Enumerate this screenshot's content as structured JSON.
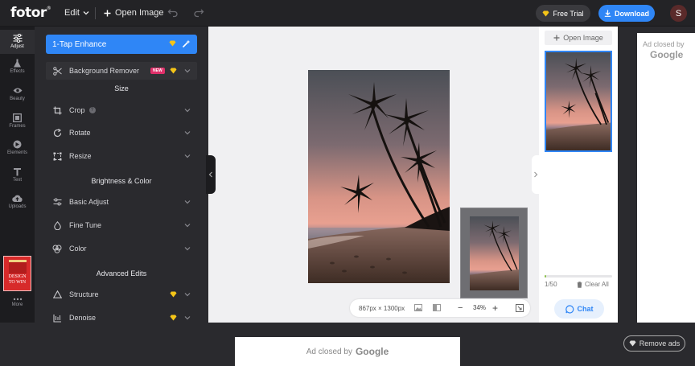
{
  "app": {
    "logo": "fotor",
    "logo_mark": "®"
  },
  "topbar": {
    "edit_label": "Edit",
    "open_image_label": "Open Image",
    "free_trial_label": "Free Trial",
    "download_label": "Download",
    "avatar_initial": "S"
  },
  "rail": {
    "items": [
      {
        "label": "Adjust",
        "icon": "sliders-icon"
      },
      {
        "label": "Effects",
        "icon": "flask-icon"
      },
      {
        "label": "Beauty",
        "icon": "eye-icon"
      },
      {
        "label": "Frames",
        "icon": "frame-icon"
      },
      {
        "label": "Elements",
        "icon": "elements-icon"
      },
      {
        "label": "Text",
        "icon": "text-icon"
      },
      {
        "label": "Uploads",
        "icon": "upload-icon"
      }
    ],
    "promo_line1": "DESIGN",
    "promo_line2": "TO WIN",
    "more_label": "More"
  },
  "panel": {
    "enhance_label": "1-Tap Enhance",
    "background_remover_label": "Background Remover",
    "new_badge": "NEW",
    "section_size": "Size",
    "crop_label": "Crop",
    "crop_help": "?",
    "rotate_label": "Rotate",
    "resize_label": "Resize",
    "section_brightness": "Brightness & Color",
    "basic_adjust_label": "Basic Adjust",
    "fine_tune_label": "Fine Tune",
    "color_label": "Color",
    "section_advanced": "Advanced Edits",
    "structure_label": "Structure",
    "denoise_label": "Denoise"
  },
  "canvas": {
    "dimensions": "867px × 1300px",
    "zoom_minus": "−",
    "zoom_value": "34%",
    "zoom_plus": "+"
  },
  "images_panel": {
    "open_image_label": "Open Image",
    "count": "1/50",
    "clear_all_label": "Clear All",
    "chat_label": "Chat",
    "progress_fraction": 0.02
  },
  "ads": {
    "right_closed_by": "Ad closed by",
    "right_google": "Google",
    "bottom_closed_by": "Ad closed by",
    "bottom_google": "Google",
    "remove_ads_label": "Remove ads"
  },
  "colors": {
    "accent": "#2f86f6",
    "topbar": "#232326",
    "panel": "#2a2a2e",
    "premium_gem": "#f5c518",
    "new_badge": "#e0306a"
  }
}
